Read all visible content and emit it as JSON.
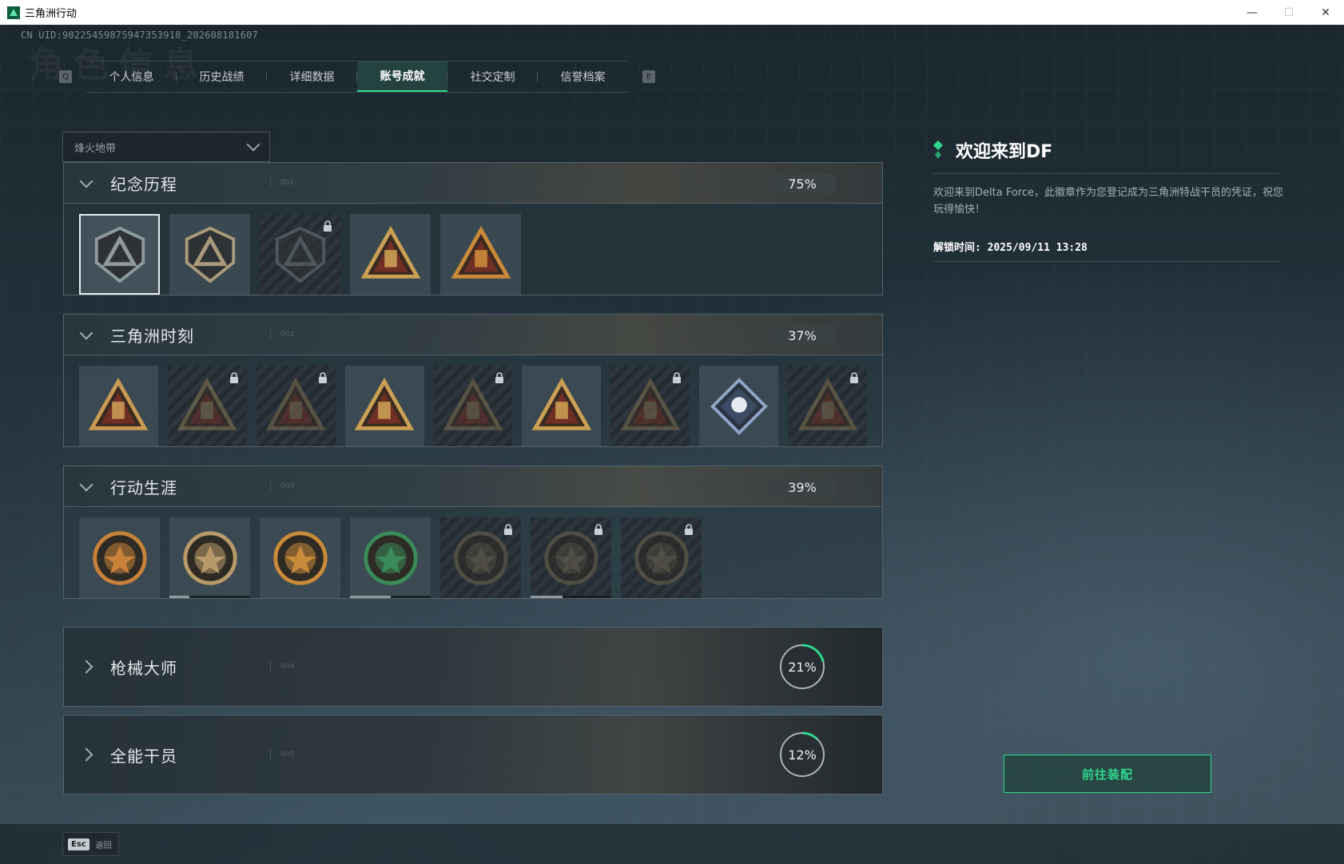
{
  "window": {
    "title": "三角洲行动",
    "minimize": "—",
    "maximize": "☐",
    "close": "✕"
  },
  "header": {
    "uid": "CN UID:9022545987594735391​8_202608181607",
    "ghost_title": "角色信息"
  },
  "tabs": {
    "left_key": "Q",
    "right_key": "E",
    "items": [
      {
        "label": "个人信息"
      },
      {
        "label": "历史战绩"
      },
      {
        "label": "详细数据"
      },
      {
        "label": "账号成就",
        "active": true
      },
      {
        "label": "社交定制"
      },
      {
        "label": "信誉档案"
      }
    ]
  },
  "dropdown": {
    "selected": "烽火地带"
  },
  "sections": [
    {
      "title": "纪念历程",
      "num": "001",
      "percent": "75%",
      "expanded": true
    },
    {
      "title": "三角洲时刻",
      "num": "002",
      "percent": "37%",
      "expanded": true
    },
    {
      "title": "行动生涯",
      "num": "003",
      "percent": "39%",
      "expanded": true
    },
    {
      "title": "枪械大师",
      "num": "004",
      "percent": "21%",
      "progress": 0.21,
      "expanded": false
    },
    {
      "title": "全能干员",
      "num": "005",
      "percent": "12%",
      "progress": 0.12,
      "expanded": false
    }
  ],
  "badges": {
    "memorial": [
      {
        "icon": "delta-shield-icon",
        "locked": false,
        "selected": true,
        "color": "#8f9aa0"
      },
      {
        "icon": "helicopter-shield-icon",
        "locked": false,
        "color": "#a89a7a"
      },
      {
        "icon": "hex-shield-icon",
        "locked": true,
        "color": "#6c777c"
      },
      {
        "icon": "helmet-triangle-icon",
        "locked": false,
        "color": "#c9a054"
      },
      {
        "icon": "number-one-triangle-icon",
        "locked": false,
        "color": "#c98a3a"
      }
    ],
    "moments": [
      {
        "icon": "flag-triangle-icon",
        "locked": false,
        "color": "#c99a54"
      },
      {
        "icon": "soldier-triangle-icon",
        "locked": true,
        "color": "#8a7a55"
      },
      {
        "icon": "hands-triangle-icon",
        "locked": true,
        "color": "#7f7050"
      },
      {
        "icon": "squad-triangle-icon",
        "locked": false,
        "color": "#c9a054"
      },
      {
        "icon": "beast-triangle-icon",
        "locked": true,
        "color": "#7f7050"
      },
      {
        "icon": "rocket-triangle-icon",
        "locked": false,
        "color": "#c9a054"
      },
      {
        "icon": "snake-triangle-icon",
        "locked": true,
        "color": "#7f7050"
      },
      {
        "icon": "rose-diamond-icon",
        "locked": false,
        "color": "#8fa6c9"
      },
      {
        "icon": "tiger-triangle-icon",
        "locked": true,
        "color": "#7f7050"
      }
    ],
    "career": [
      {
        "icon": "star-medal-icon",
        "locked": false,
        "color": "#c9823a",
        "progress": null
      },
      {
        "icon": "bronze-shield-medal-icon",
        "locked": false,
        "color": "#b89a6a",
        "progress": 0.25
      },
      {
        "icon": "gold-shield-medal-icon",
        "locked": false,
        "color": "#c98a3a",
        "progress": null
      },
      {
        "icon": "green-shield-medal-icon",
        "locked": false,
        "color": "#3a8a5a",
        "progress": 0.5
      },
      {
        "icon": "bullet-medal-icon",
        "locked": true,
        "color": "#6f6550",
        "progress": null
      },
      {
        "icon": "skull-medal-icon",
        "locked": true,
        "color": "#6f6550",
        "progress": 0.4
      },
      {
        "icon": "eye-medal-icon",
        "locked": true,
        "color": "#6f6550",
        "progress": null
      }
    ]
  },
  "detail": {
    "title": "欢迎来到DF",
    "description": "欢迎来到Delta Force，此徽章作为您登记成为三角洲特战干员的凭证，祝您玩得愉快！",
    "unlock_time": "解锁时间: 2025/09/11 13:28",
    "equip_button": "前往装配"
  },
  "footer": {
    "esc_key": "Esc",
    "back_label": "返回"
  },
  "colors": {
    "accent": "#2fd98f",
    "panel_border": "#56636b"
  }
}
